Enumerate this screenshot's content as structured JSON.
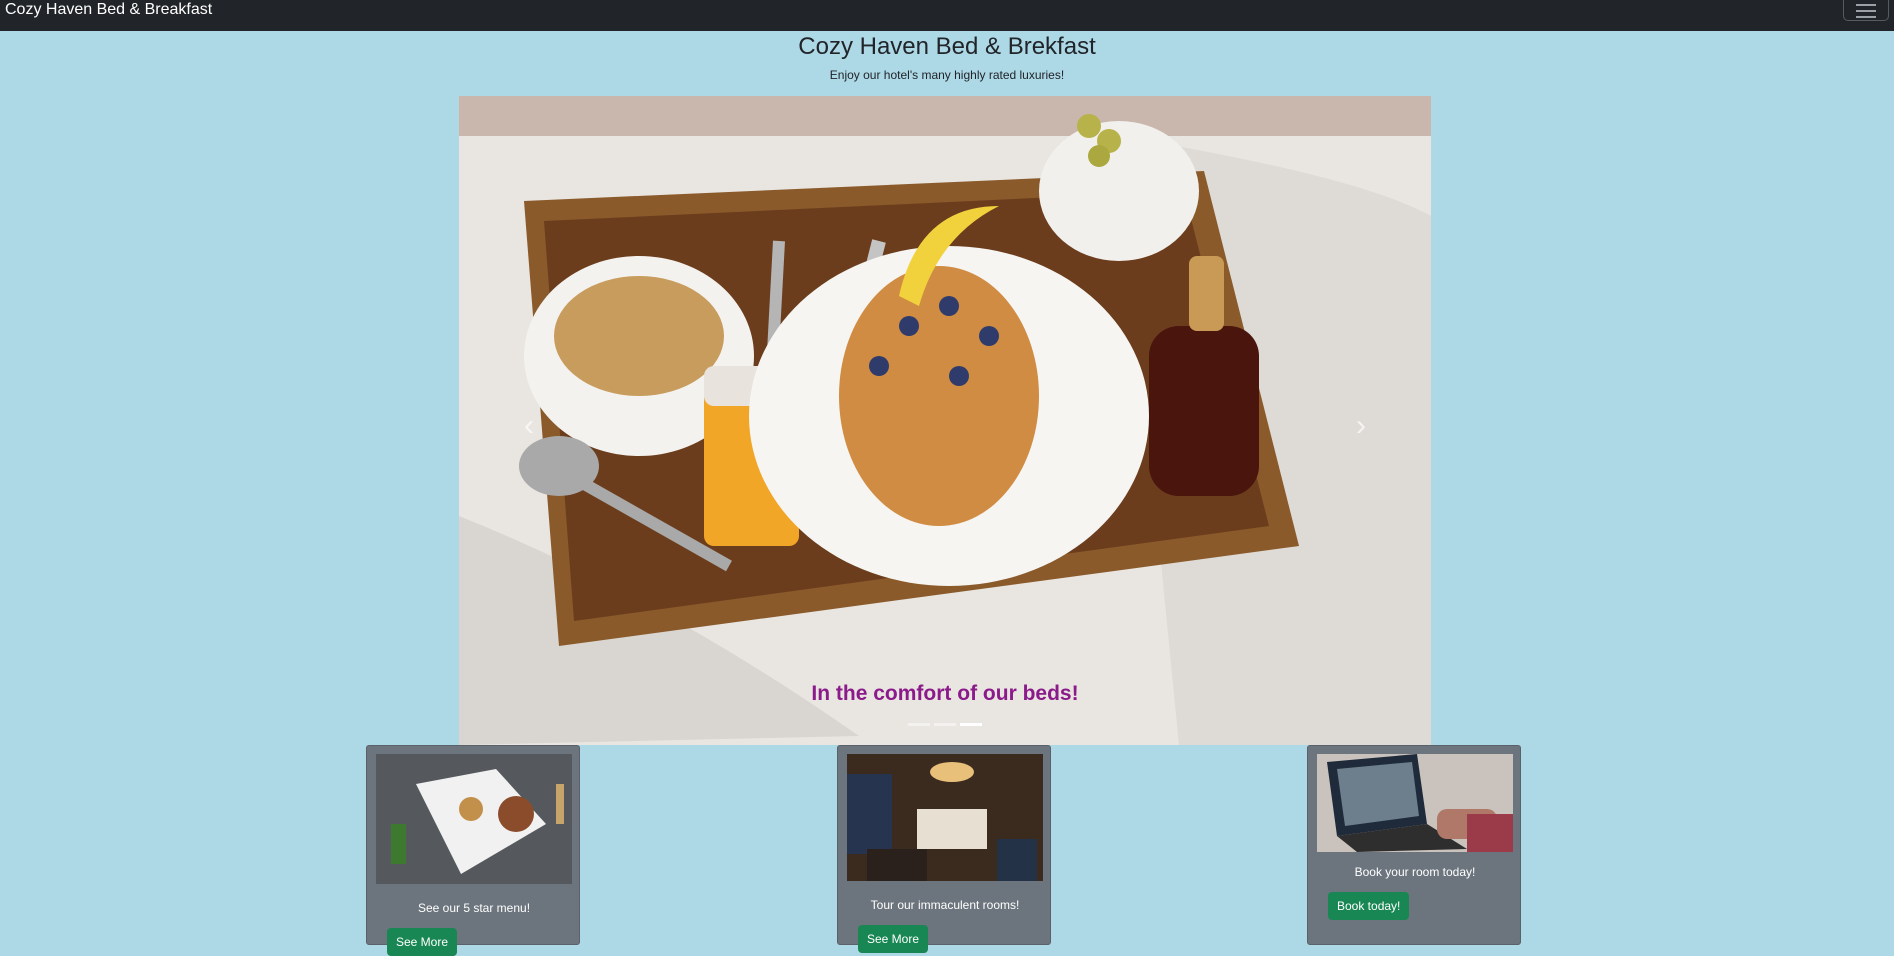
{
  "navbar": {
    "brand": "Cozy Haven Bed & Breakfast",
    "toggle_icon": "hamburger-icon"
  },
  "header": {
    "title": "Cozy Haven Bed & Brekfast",
    "subtitle": "Enjoy our hotel's many highly rated luxuries!"
  },
  "carousel": {
    "caption": "In the comfort of our beds!",
    "slide_count": 3,
    "active_slide": 3,
    "prev_icon": "chevron-left-icon",
    "next_icon": "chevron-right-icon"
  },
  "cards": [
    {
      "text": "See our 5 star menu!",
      "button": "See More"
    },
    {
      "text": "Tour our immaculent rooms!",
      "button": "See More"
    },
    {
      "text": "Book your room today!",
      "button": "Book today!"
    }
  ],
  "colors": {
    "background": "#add8e6",
    "navbar": "#212529",
    "caption": "#8b1a8b",
    "card": "#6c757d",
    "button": "#198754"
  }
}
